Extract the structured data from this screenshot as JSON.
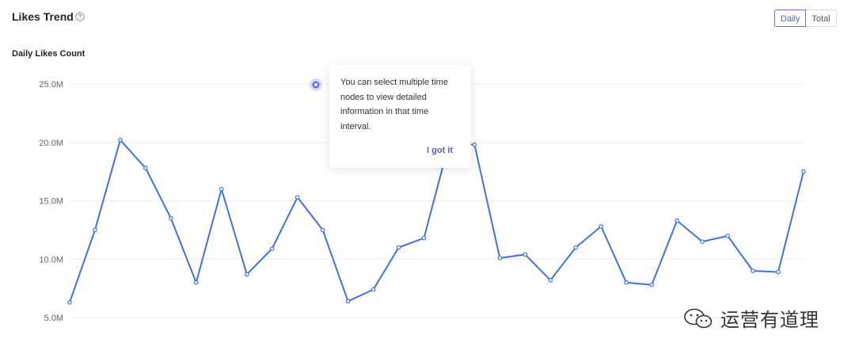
{
  "header": {
    "title": "Likes Trend",
    "toggle": [
      "Daily",
      "Total"
    ],
    "active": "Daily"
  },
  "chart_data": {
    "type": "line",
    "title": "Daily Likes Count",
    "xlabel": "",
    "ylabel": "",
    "yticks": [
      "5.0M",
      "10.0M",
      "15.0M",
      "20.0M",
      "25.0M"
    ],
    "ylim": [
      5,
      25
    ],
    "unit": "M",
    "grid": true,
    "series": [
      {
        "values": [
          6.3,
          12.5,
          20.2,
          17.8,
          13.5,
          8.0,
          16.0,
          8.7,
          10.9,
          15.3,
          12.5,
          6.4,
          7.4,
          11.0,
          11.8,
          20.0,
          19.8,
          10.1,
          10.4,
          8.2,
          11.0,
          12.8,
          8.0,
          7.8,
          13.3,
          11.5,
          12.0,
          9.0,
          8.9,
          17.5
        ]
      }
    ],
    "color": "#3f72e0",
    "marker_color": "#6b6be0"
  },
  "tooltip": {
    "text": "You can select multiple time nodes to view detailed information in that time interval.",
    "button": "I got it"
  },
  "watermark": {
    "text": "运营有道理"
  }
}
